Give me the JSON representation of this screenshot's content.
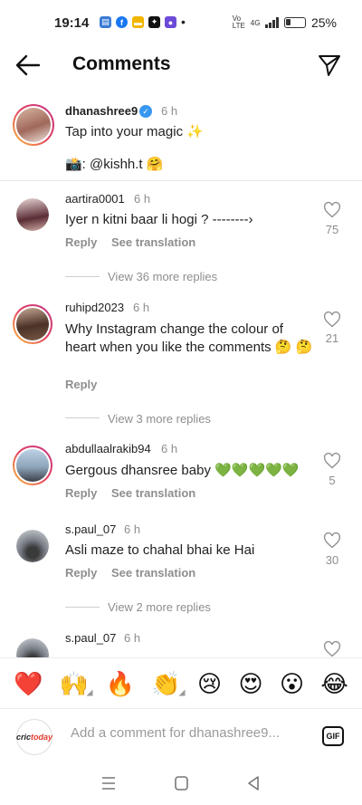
{
  "status": {
    "time": "19:14",
    "battery": "25%",
    "network": "4G"
  },
  "header": {
    "title": "Comments"
  },
  "caption": {
    "username": "dhanashree9",
    "time": "6 h",
    "text": "Tap into your magic ✨",
    "credit": "📸: @kishh.t 🤗"
  },
  "comments": [
    {
      "username": "aartira0001",
      "time": "6 h",
      "text": "Iyer n kitni baar li hogi ? --------›",
      "likes": "75",
      "reply": "Reply",
      "translate": "See translation",
      "more": "View 36 more replies"
    },
    {
      "username": "ruhipd2023",
      "time": "6 h",
      "text": "Why Instagram change the colour of heart when you like the comments 🤔 🤔",
      "likes": "21",
      "reply": "Reply",
      "more": "View 3 more replies"
    },
    {
      "username": "abdullaalrakib94",
      "time": "6 h",
      "text": "Gergous dhansree baby 💚💚💚💚💚",
      "likes": "5",
      "reply": "Reply",
      "translate": "See translation"
    },
    {
      "username": "s.paul_07",
      "time": "6 h",
      "text": "Asli maze to chahal bhai ke Hai",
      "likes": "30",
      "reply": "Reply",
      "translate": "See translation",
      "more": "View 2 more replies"
    },
    {
      "username": "s.paul_07",
      "time": "6 h",
      "text": ""
    }
  ],
  "emojis": [
    "❤️",
    "🙌",
    "🔥",
    "👏",
    "😢",
    "😍",
    "😮",
    "😂"
  ],
  "input": {
    "placeholder": "Add a comment for dhanashree9...",
    "avatar_label_a": "cric",
    "avatar_label_b": "today"
  },
  "gif_label": "GIF",
  "colors": {
    "accent": "#3897f0",
    "ring_start": "#f9c23c",
    "ring_end": "#c13584"
  }
}
